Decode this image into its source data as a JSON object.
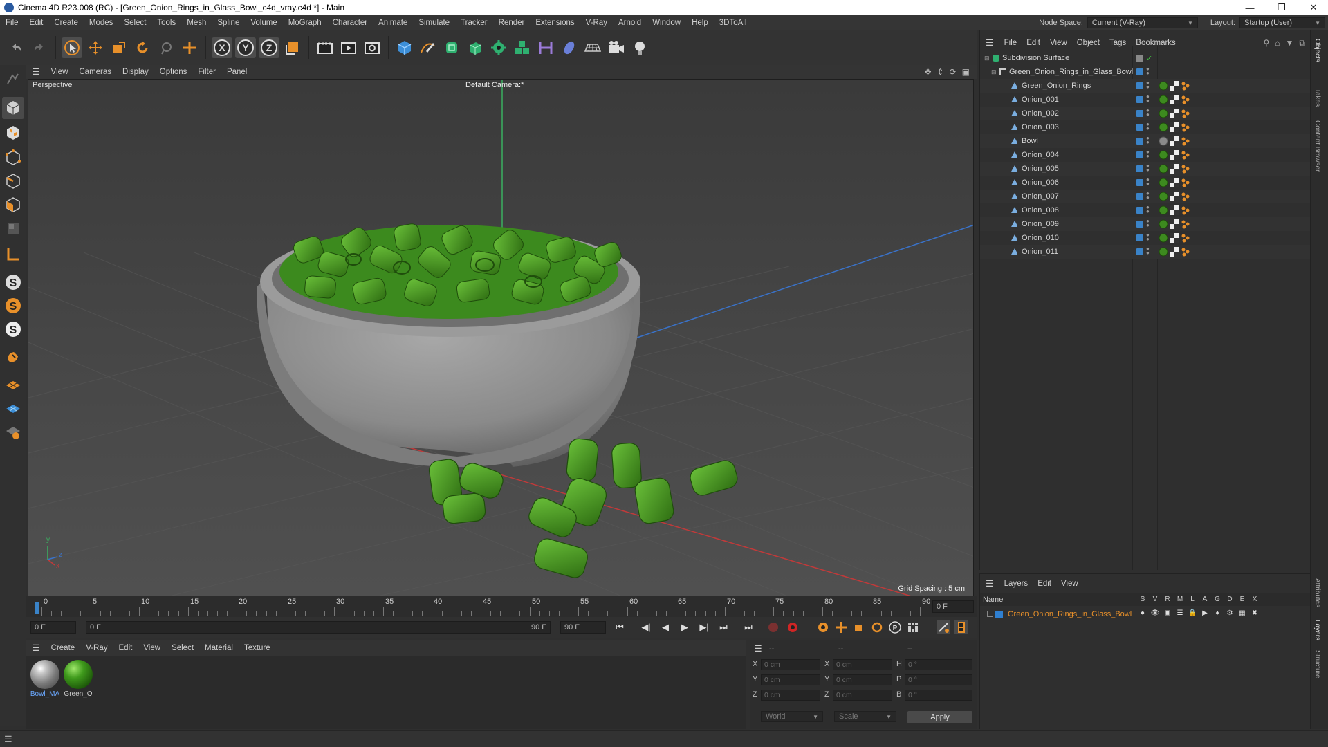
{
  "window": {
    "title": "Cinema 4D R23.008 (RC) - [Green_Onion_Rings_in_Glass_Bowl_c4d_vray.c4d *] - Main"
  },
  "menubar": {
    "items": [
      "File",
      "Edit",
      "Create",
      "Modes",
      "Select",
      "Tools",
      "Mesh",
      "Spline",
      "Volume",
      "MoGraph",
      "Character",
      "Animate",
      "Simulate",
      "Tracker",
      "Render",
      "Extensions",
      "V-Ray",
      "Arnold",
      "Window",
      "Help",
      "3DToAll"
    ],
    "node_space_label": "Node Space:",
    "node_space_value": "Current (V-Ray)",
    "layout_label": "Layout:",
    "layout_value": "Startup (User)"
  },
  "viewport": {
    "menu": [
      "View",
      "Cameras",
      "Display",
      "Options",
      "Filter",
      "Panel"
    ],
    "view_name": "Perspective",
    "camera": "Default Camera",
    "camera_suffix": ":*",
    "grid_spacing": "Grid Spacing : 5 cm",
    "axis_y": "y",
    "axis_z": "z",
    "axis_x": "x"
  },
  "timeline": {
    "ticks": [
      "0",
      "5",
      "10",
      "15",
      "20",
      "25",
      "30",
      "35",
      "40",
      "45",
      "50",
      "55",
      "60",
      "65",
      "70",
      "75",
      "80",
      "85",
      "90"
    ],
    "end_frame_field": "0 F",
    "current_frame": "0 F",
    "range_start": "0 F",
    "range_end": "90 F",
    "max_frame": "90 F"
  },
  "materials": {
    "menu": [
      "Create",
      "V-Ray",
      "Edit",
      "View",
      "Select",
      "Material",
      "Texture"
    ],
    "items": [
      {
        "name": "Bowl_MA",
        "kind": "glass"
      },
      {
        "name": "Green_O",
        "kind": "green"
      }
    ]
  },
  "coords": {
    "headers": [
      "--",
      "--",
      "--"
    ],
    "rows": [
      {
        "a": "X",
        "a_val": "0 cm",
        "b": "X",
        "b_val": "0 cm",
        "c": "H",
        "c_val": "0 °"
      },
      {
        "a": "Y",
        "a_val": "0 cm",
        "b": "Y",
        "b_val": "0 cm",
        "c": "P",
        "c_val": "0 °"
      },
      {
        "a": "Z",
        "a_val": "0 cm",
        "b": "Z",
        "b_val": "0 cm",
        "c": "B",
        "c_val": "0 °"
      }
    ],
    "space": "World",
    "mode": "Scale",
    "apply": "Apply"
  },
  "objects": {
    "menu": [
      "File",
      "Edit",
      "View",
      "Object",
      "Tags",
      "Bookmarks"
    ],
    "root": "Subdivision Surface",
    "group": "Green_Onion_Rings_in_Glass_Bowl",
    "children": [
      "Green_Onion_Rings",
      "Onion_001",
      "Onion_002",
      "Onion_003",
      "Bowl",
      "Onion_004",
      "Onion_005",
      "Onion_006",
      "Onion_007",
      "Onion_008",
      "Onion_009",
      "Onion_010",
      "Onion_011"
    ]
  },
  "layers": {
    "menu": [
      "Layers",
      "Edit",
      "View"
    ],
    "name_header": "Name",
    "col_headers": [
      "S",
      "V",
      "R",
      "M",
      "L",
      "A",
      "G",
      "D",
      "E",
      "X"
    ],
    "items": [
      {
        "name": "Green_Onion_Rings_in_Glass_Bowl",
        "color": "#2f7fd0"
      }
    ]
  },
  "right_tabs": [
    "Objects",
    "Takes",
    "Content Browser",
    "Attributes",
    "Layers",
    "Structure"
  ],
  "colors": {
    "accent_orange": "#e8902a",
    "layer_name": "#e8902a",
    "tag_blue": "#3a83c8",
    "onion_green": "#4a9a22"
  }
}
